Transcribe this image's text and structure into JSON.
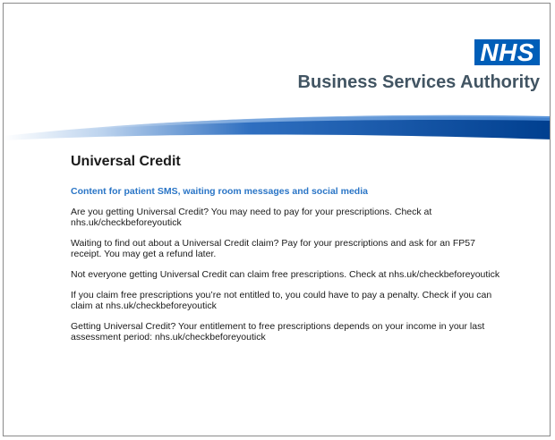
{
  "header": {
    "logo_text": "NHS",
    "org_name": "Business Services Authority",
    "logo_color": "#005eb8",
    "org_color": "#425563"
  },
  "document": {
    "title": "Universal Credit",
    "subheading": "Content for patient SMS, waiting room messages and social media",
    "subheading_color": "#2a75c6",
    "messages": [
      "Are you getting Universal Credit? You may need to pay for your prescriptions. Check at nhs.uk/checkbeforeyoutick",
      "Waiting to find out about a Universal Credit claim? Pay for your prescriptions and ask for an FP57 receipt. You may get a refund later.",
      "Not everyone getting Universal Credit can claim free prescriptions. Check at nhs.uk/checkbeforeyoutick",
      "If you claim free prescriptions you’re not entitled to, you could have to pay a penalty. Check if you can claim at nhs.uk/checkbeforeyoutick",
      "Getting Universal Credit? Your entitlement to free prescriptions depends on your income in your last assessment period: nhs.uk/checkbeforeyoutick"
    ]
  }
}
